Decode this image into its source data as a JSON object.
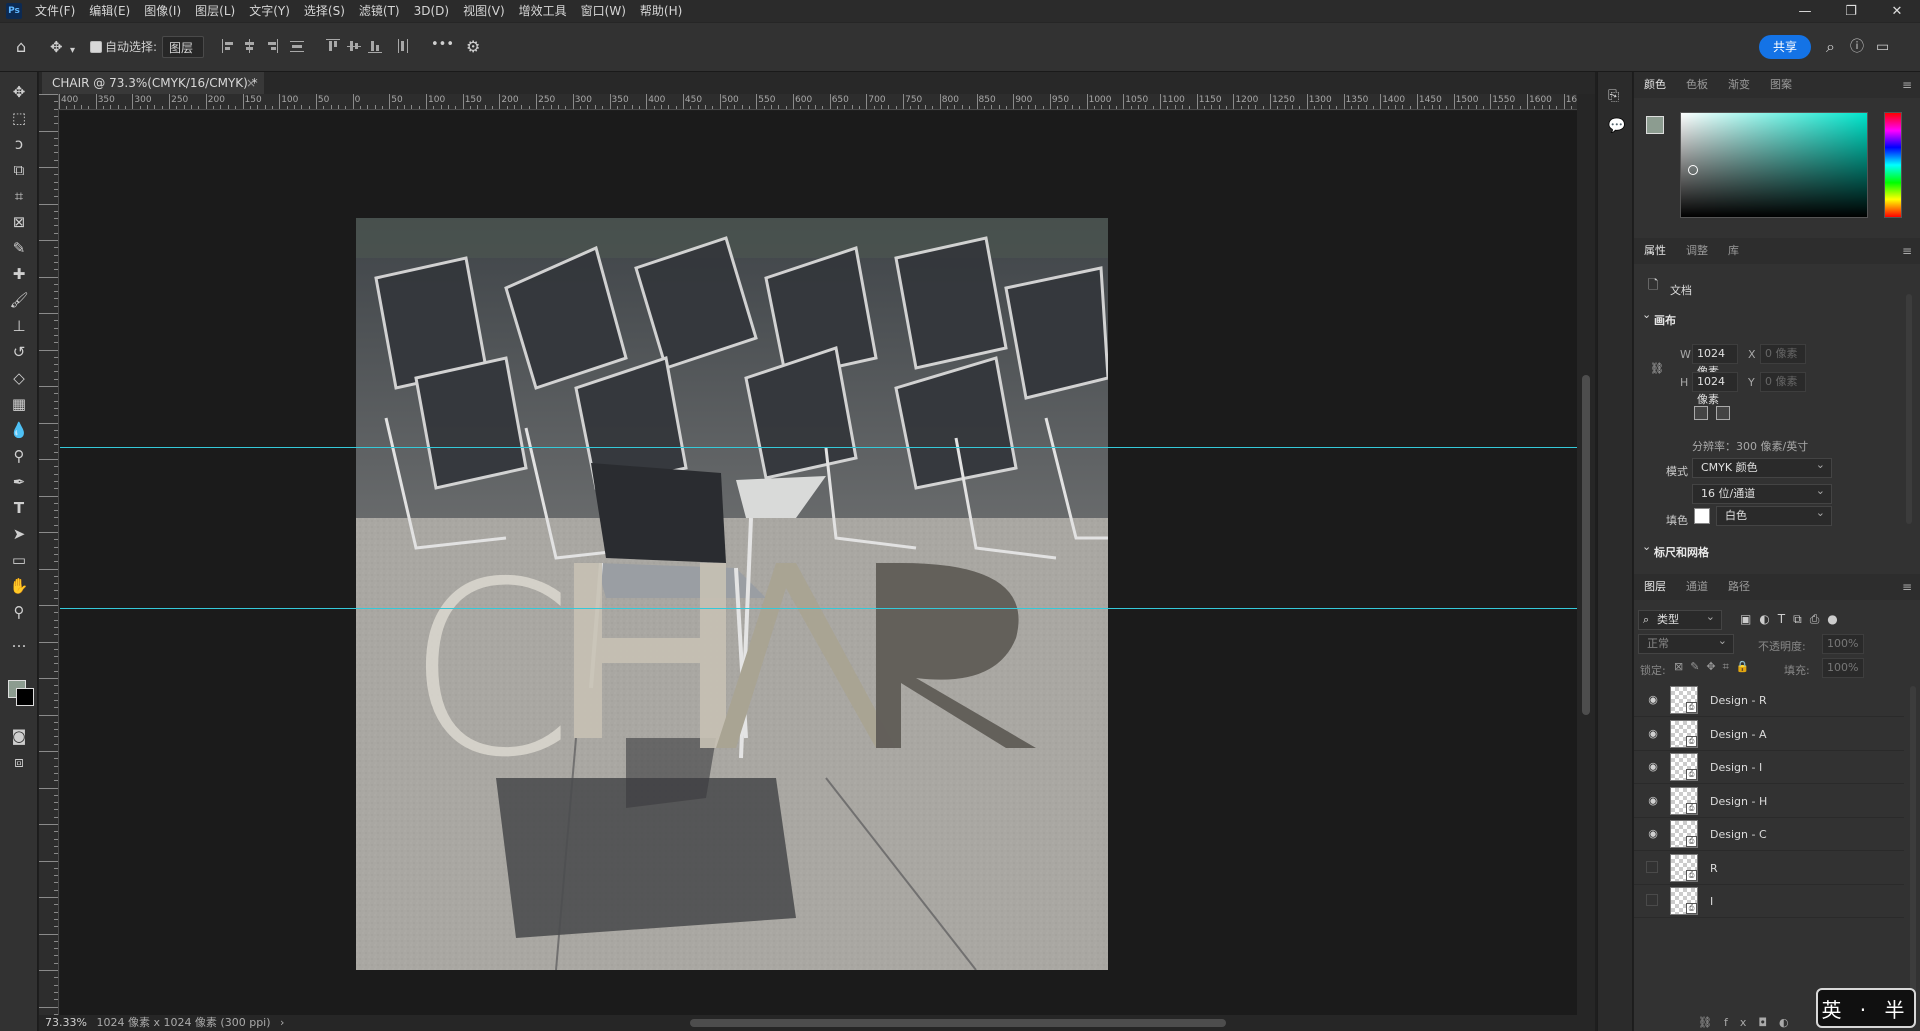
{
  "app": {
    "logo": "Ps"
  },
  "menu": [
    "文件(F)",
    "编辑(E)",
    "图像(I)",
    "图层(L)",
    "文字(Y)",
    "选择(S)",
    "滤镜(T)",
    "3D(D)",
    "视图(V)",
    "增效工具",
    "窗口(W)",
    "帮助(H)"
  ],
  "window_controls": {
    "minimize": "—",
    "restore": "❐",
    "close": "✕"
  },
  "options": {
    "auto_select_label": "自动选择:",
    "auto_select_target": "图层",
    "more": "•••",
    "share": "共享"
  },
  "document": {
    "tab_title": "CHAIR @ 73.3%(CMYK/16/CMYK) *",
    "zoom": "73.33%",
    "size_info": "1024 像素 x 1024 像素 (300 ppi)",
    "artwork_text": "CHAIR"
  },
  "ruler": {
    "labels": [
      "400",
      "350",
      "300",
      "250",
      "200",
      "150",
      "100",
      "50",
      "0",
      "50",
      "100",
      "150",
      "200",
      "250",
      "300",
      "350",
      "400",
      "450",
      "500",
      "550",
      "600",
      "650",
      "700",
      "750",
      "800",
      "850",
      "900",
      "950",
      "1000",
      "1050",
      "1100",
      "1150",
      "1200",
      "1250",
      "1300",
      "1350",
      "1400",
      "1450",
      "1500",
      "1550",
      "1600",
      "16"
    ]
  },
  "color_panel": {
    "tabs": [
      "颜色",
      "色板",
      "渐变",
      "图案"
    ],
    "hue_color": "#00e5cc"
  },
  "properties": {
    "tabs": [
      "属性",
      "调整",
      "库"
    ],
    "doc_label": "文档",
    "canvas_section": "画布",
    "w_label": "W",
    "w_value": "1024 像素",
    "h_label": "H",
    "h_value": "1024 像素",
    "x_label": "X",
    "x_placeholder": "0 像素",
    "y_label": "Y",
    "y_placeholder": "0 像素",
    "resolution": "分辨率：300 像素/英寸",
    "mode_label": "模式",
    "mode_value": "CMYK 颜色",
    "depth_value": "16 位/通道",
    "fill_label": "填色",
    "fill_value": "白色",
    "rulers_section": "标尺和网格"
  },
  "layers_panel": {
    "tabs": [
      "图层",
      "通道",
      "路径"
    ],
    "filter": "类型",
    "blend_mode": "正常",
    "opacity_label": "不透明度:",
    "opacity_value": "100%",
    "lock_label": "锁定:",
    "fill_label": "填充:",
    "fill_value": "100%",
    "layers": [
      {
        "name": "Design - R",
        "visible": true
      },
      {
        "name": "Design - A",
        "visible": true
      },
      {
        "name": "Design - I",
        "visible": true
      },
      {
        "name": "Design - H",
        "visible": true
      },
      {
        "name": "Design - C",
        "visible": true
      },
      {
        "name": "R",
        "visible": false
      },
      {
        "name": "I",
        "visible": false
      }
    ]
  },
  "ime": {
    "text": "英 · 半"
  }
}
